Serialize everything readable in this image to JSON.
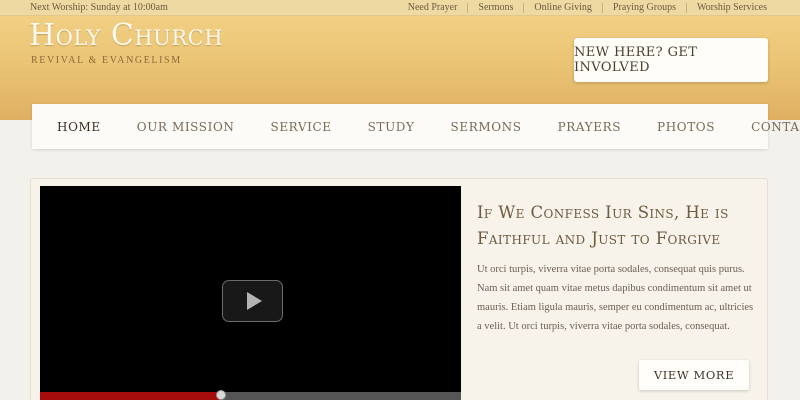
{
  "topbar": {
    "worship_text": "Next Worship: Sunday at 10:00am",
    "links": [
      "Need Prayer",
      "Sermons",
      "Online Giving",
      "Praying Groups",
      "Worship Services"
    ]
  },
  "header": {
    "logo_title": "Holy Church",
    "logo_subtitle": "REVIVAL & EVANGELISM",
    "cta_label": "NEW HERE? GET INVOLVED"
  },
  "nav": {
    "items": [
      "HOME",
      "OUR MISSION",
      "SERVICE",
      "STUDY",
      "SERMONS",
      "PRAYERS",
      "PHOTOS",
      "CONTACTS"
    ],
    "active_index": 0
  },
  "feature": {
    "headline": "If We Confess Iur Sins, He is Faithful and Just to Forgive",
    "body": "Ut orci turpis, viverra vitae porta sodales, consequat quis purus. Nam sit amet quam vitae metus dapibus condimentum sit amet ut mauris. Etiam ligula mauris, semper eu condimentum ac, ultricies a velit. Ut orci turpis, viverra vitae porta sodales, consequat.",
    "button_label": "VIEW MORE"
  },
  "video": {
    "play_icon": "play-icon",
    "progress_fraction": 0.43
  },
  "colors": {
    "header_gold": "#ebc475",
    "progress_red": "#a50d0d",
    "headline_brown": "#6e5a40"
  }
}
